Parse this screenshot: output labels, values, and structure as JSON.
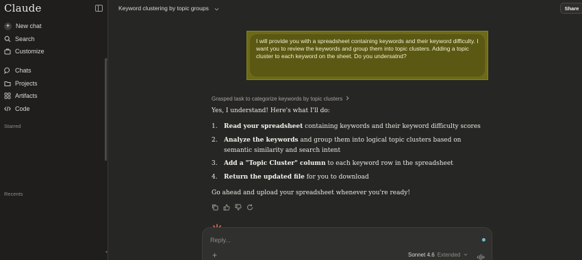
{
  "app": {
    "name": "Claude"
  },
  "sidebar": {
    "nav": [
      {
        "label": "New chat",
        "icon": "plus-circle-icon"
      },
      {
        "label": "Search",
        "icon": "search-icon"
      },
      {
        "label": "Customize",
        "icon": "briefcase-icon"
      },
      {
        "label": "Chats",
        "icon": "chat-bubble-icon"
      },
      {
        "label": "Projects",
        "icon": "folder-icon"
      },
      {
        "label": "Artifacts",
        "icon": "grid-icon"
      },
      {
        "label": "Code",
        "icon": "code-icon"
      }
    ],
    "sections": {
      "starred": "Starred",
      "recents": "Recents"
    }
  },
  "topbar": {
    "title": "Keyword clustering by topic groups",
    "share_label": "Share"
  },
  "conversation": {
    "user_message": "I will provide you with a spreadsheet containing keywords and their keyword difficulty. I want you to review the keywords and group them into topic clusters. Adding a topic cluster to each keyword on the sheet. Do you undersatnd?",
    "thought_summary": "Grasped task to categorize keywords by topic clusters",
    "assistant_intro": "Yes, I understand! Here's what I'll do:",
    "steps": [
      {
        "num": "1.",
        "bold": "Read your spreadsheet",
        "rest": " containing keywords and their keyword difficulty scores"
      },
      {
        "num": "2.",
        "bold": "Analyze the keywords",
        "rest": " and group them into logical topic clusters based on semantic similarity and search intent"
      },
      {
        "num": "3.",
        "bold": "Add a \"Topic Cluster\" column",
        "rest": " to each keyword row in the spreadsheet"
      },
      {
        "num": "4.",
        "bold": "Return the updated file",
        "rest": " for you to download"
      }
    ],
    "assistant_closing": "Go ahead and upload your spreadsheet whenever you're ready!"
  },
  "composer": {
    "placeholder": "Reply...",
    "model": "Sonnet 4.6",
    "mode": "Extended"
  },
  "colors": {
    "background": "#262624",
    "sidebar": "#1f1e1d",
    "highlight": "#6d6a16",
    "accent": "#d97757"
  }
}
